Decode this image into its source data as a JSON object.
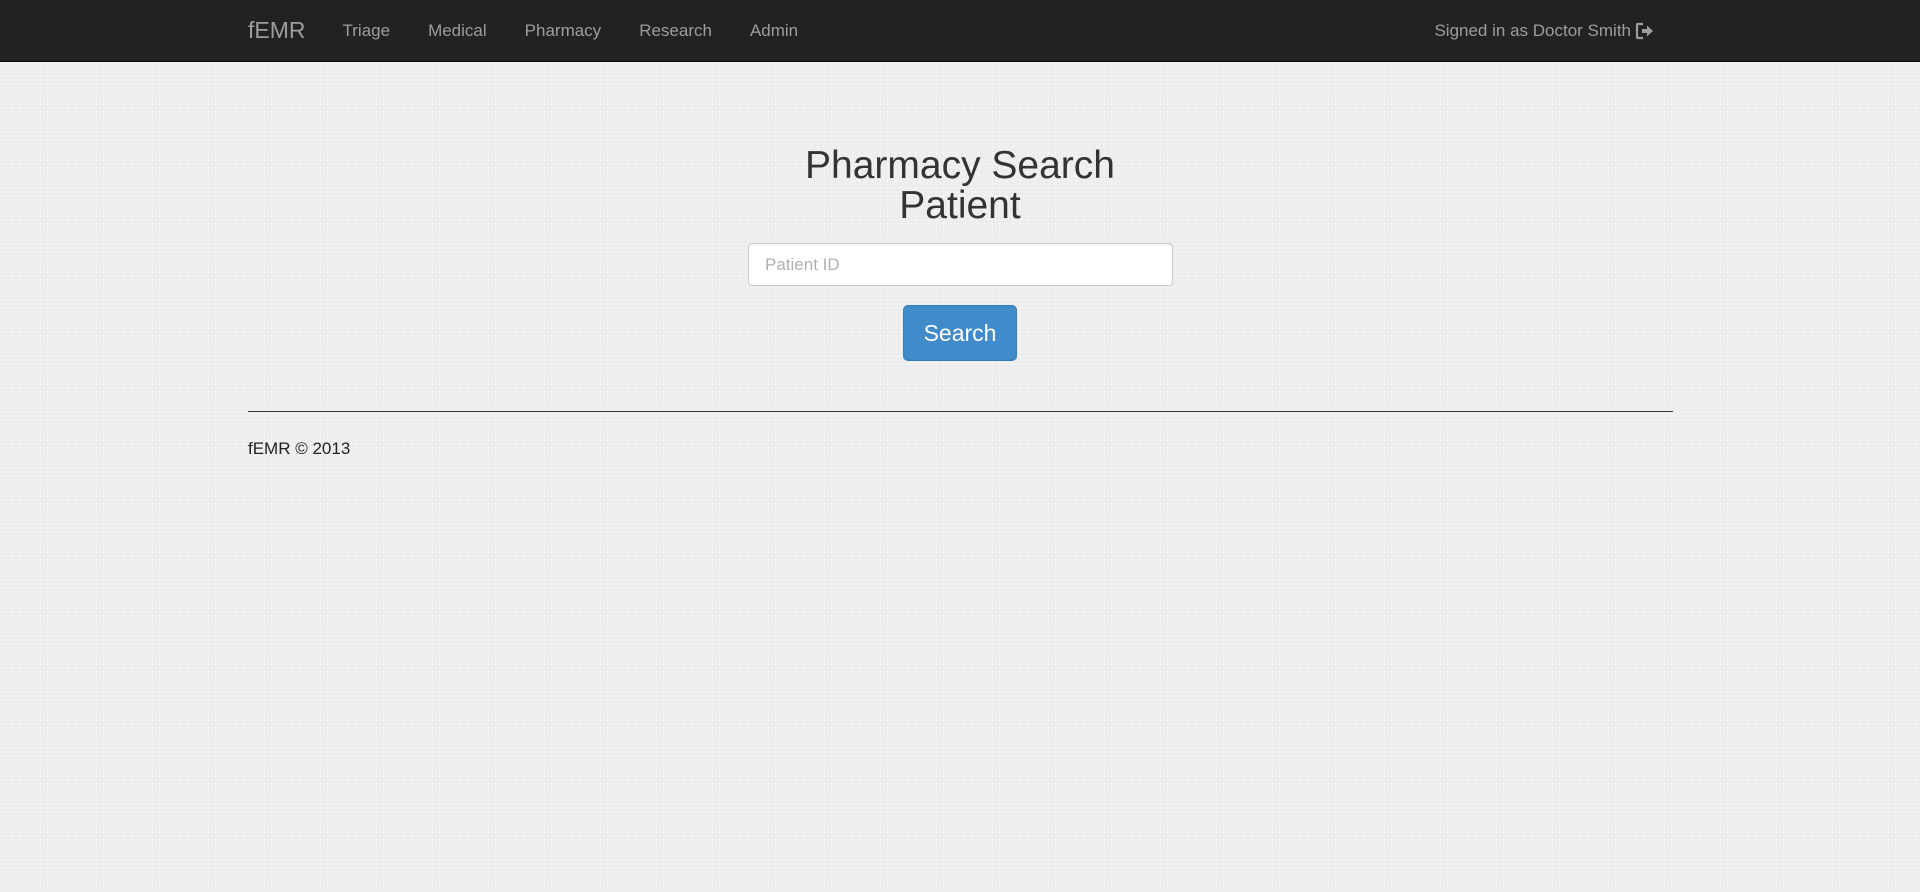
{
  "nav": {
    "brand": "fEMR",
    "links": [
      {
        "label": "Triage"
      },
      {
        "label": "Medical"
      },
      {
        "label": "Pharmacy"
      },
      {
        "label": "Research"
      },
      {
        "label": "Admin"
      }
    ],
    "user_text": "Signed in as Doctor Smith",
    "signout_icon": "sign-out-icon"
  },
  "main": {
    "title_line1": "Pharmacy Search",
    "title_line2": "Patient",
    "search": {
      "placeholder": "Patient ID",
      "value": ""
    },
    "search_button_label": "Search"
  },
  "footer": {
    "text": "fEMR © 2013"
  },
  "colors": {
    "navbar_bg": "#222222",
    "nav_text": "#9d9d9d",
    "button_bg": "#428bca",
    "page_bg": "#efefef"
  }
}
